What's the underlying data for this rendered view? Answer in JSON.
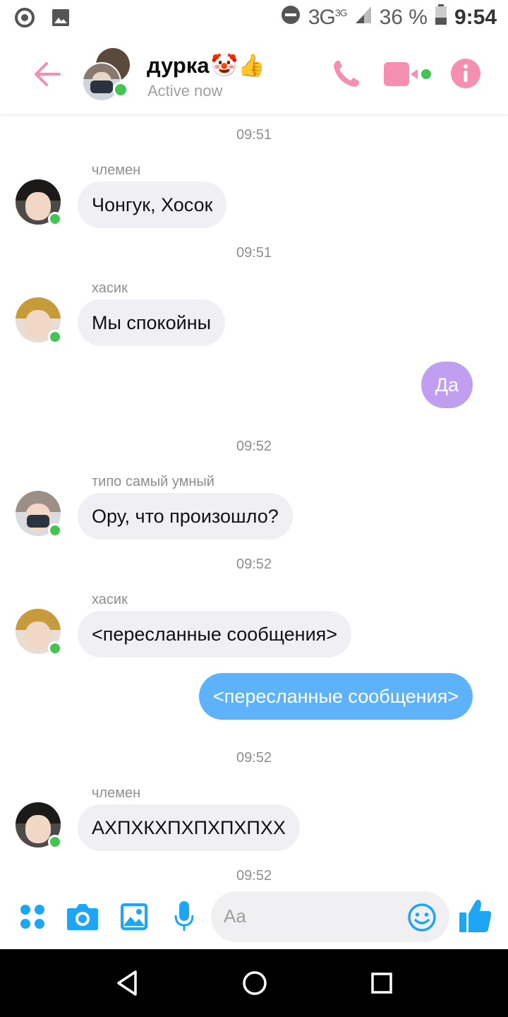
{
  "status_bar": {
    "network": "3G",
    "network_sup": "3G",
    "battery": "36 %",
    "time": "9:54"
  },
  "header": {
    "title": "дурка",
    "title_emojis": "🤡👍",
    "status": "Active now"
  },
  "messages": [
    {
      "type": "timestamp",
      "text": "09:51"
    },
    {
      "type": "incoming",
      "sender": "члемен",
      "text": "Чонгук, Хосок"
    },
    {
      "type": "timestamp",
      "text": "09:51"
    },
    {
      "type": "incoming",
      "sender": "хасик",
      "text": "Мы спокойны"
    },
    {
      "type": "outgoing",
      "text": "Да"
    },
    {
      "type": "timestamp",
      "text": "09:52"
    },
    {
      "type": "incoming",
      "sender": "типо самый умный",
      "text": "Ору, что произошло?"
    },
    {
      "type": "timestamp",
      "text": "09:52"
    },
    {
      "type": "incoming",
      "sender": "хасик",
      "text": "<пересланные сообщения>"
    },
    {
      "type": "outgoing",
      "text": "<пересланные сообщения>"
    },
    {
      "type": "timestamp",
      "text": "09:52"
    },
    {
      "type": "incoming",
      "sender": "члемен",
      "text": "АХПХКХПХПХПХПХХ"
    },
    {
      "type": "timestamp",
      "text": "09:52"
    }
  ],
  "composer": {
    "placeholder": "Aa",
    "icons": [
      "apps-icon",
      "camera-icon",
      "gallery-icon",
      "microphone-icon",
      "emoji-icon",
      "thumbs-up-icon"
    ]
  },
  "colors": {
    "accent_pink": "#f48fb1",
    "accent_blue": "#1ea5f4",
    "bubble_in": "#efeff4",
    "bubble_purple": "#c19ff0",
    "bubble_blue": "#5eb2f9",
    "online": "#44c552"
  }
}
